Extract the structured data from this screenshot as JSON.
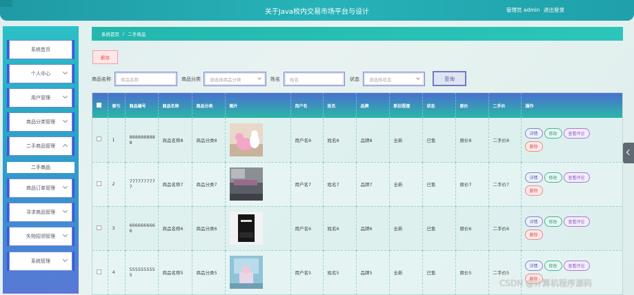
{
  "header": {
    "title": "关于Java校内交易市场平台与设计",
    "admin_text": "管理员 admin",
    "logout_label": "退出登录"
  },
  "sidebar": {
    "items": [
      {
        "label": "系统首页",
        "has_chevron": false
      },
      {
        "label": "个人中心",
        "has_chevron": true
      },
      {
        "label": "用户管理",
        "has_chevron": true
      },
      {
        "label": "商品分类管理",
        "has_chevron": true
      },
      {
        "label": "二手商品管理",
        "has_chevron": true,
        "expanded": true
      },
      {
        "label": "商品订单管理",
        "has_chevron": true
      },
      {
        "label": "寻求商品管理",
        "has_chevron": true
      },
      {
        "label": "失物招领管理",
        "has_chevron": true
      },
      {
        "label": "系统管理",
        "has_chevron": true
      }
    ],
    "submenu": [
      {
        "label": "二手商品"
      }
    ]
  },
  "breadcrumb": {
    "home": "系统首页",
    "separator": "/",
    "current": "二手商品"
  },
  "toolbar": {
    "delete_label": "删除",
    "query_label": "查询"
  },
  "search": {
    "name_label": "商品名称",
    "name_placeholder": "商品名称",
    "category_label": "商品分类",
    "category_placeholder": "请选择商品分类",
    "username_label": "姓名",
    "username_placeholder": "姓名",
    "status_label": "状态",
    "status_placeholder": "请选择状态"
  },
  "table": {
    "headers": [
      "索引",
      "商品编号",
      "商品名称",
      "商品分类",
      "图片",
      "用户名",
      "姓名",
      "品牌",
      "新旧程度",
      "状态",
      "原价",
      "二手价",
      "操作"
    ],
    "rows": [
      {
        "index": "1",
        "code": "8888888888",
        "name": "商品名称8",
        "category": "商品分类8",
        "image": "pink-toy",
        "username": "用户名8",
        "realname": "姓名8",
        "brand": "品牌8",
        "condition": "全新",
        "status": "已售",
        "price": "原价8",
        "used_price": "二手价8"
      },
      {
        "index": "2",
        "code": "7777777777",
        "name": "商品名称7",
        "category": "商品分类7",
        "image": "bedroom",
        "username": "用户名7",
        "realname": "姓名7",
        "brand": "品牌7",
        "condition": "全新",
        "status": "已售",
        "price": "原价7",
        "used_price": "二手价7"
      },
      {
        "index": "3",
        "code": "6666666666",
        "name": "商品名称6",
        "category": "商品分类6",
        "image": "black-book",
        "username": "用户名6",
        "realname": "姓名6",
        "brand": "品牌6",
        "condition": "全新",
        "status": "已售",
        "price": "原价6",
        "used_price": "二手价6"
      },
      {
        "index": "4",
        "code": "5555555555",
        "name": "商品名称5",
        "category": "商品分类5",
        "image": "blue-room",
        "username": "用户名5",
        "realname": "姓名5",
        "brand": "品牌5",
        "condition": "全新",
        "status": "已售",
        "price": "原价5",
        "used_price": "二手价5"
      }
    ],
    "ops": {
      "detail": "详情",
      "edit": "修改",
      "review": "查看评论",
      "delete": "删除"
    }
  },
  "watermark": "CSDN @计算机程序源码",
  "colors": {
    "header": "#27b3b8",
    "breadcrumb": "#2bc5b9",
    "table_head_top": "#4a6fd0",
    "delete": "#e05a5a"
  }
}
